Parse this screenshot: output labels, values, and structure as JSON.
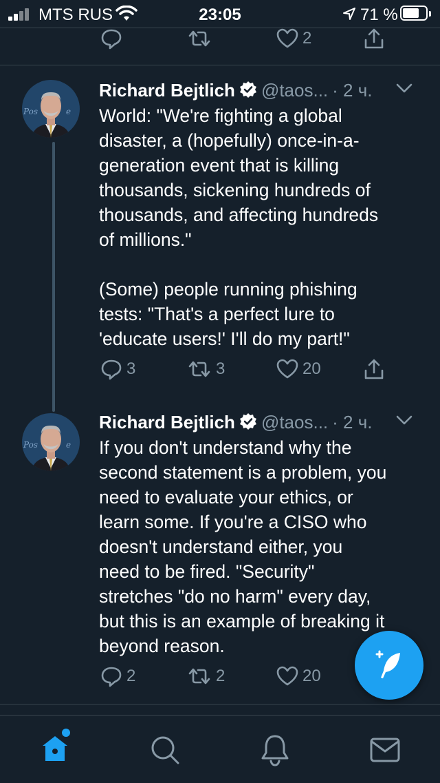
{
  "status_bar": {
    "carrier": "MTS RUS",
    "time": "23:05",
    "battery": "71 %",
    "battery_level": 0.71,
    "icons": [
      "signal-icon",
      "wifi-icon",
      "location-icon",
      "battery-icon"
    ]
  },
  "top_actions": {
    "reply": "",
    "retweet": "",
    "like": "2"
  },
  "tweets": [
    {
      "name": "Richard Bejtlich",
      "handle": "@taos...",
      "time": "· 2 ч.",
      "text": "World: \"We're fighting a global\ndisaster, a (hopefully) once-in-a-\ngeneration event that is killing\nthousands, sickening hundreds of\nthousands, and affecting hundreds\nof millions.\"\n\n(Some) people running phishing\ntests: \"That's a perfect lure to\n'educate users!' I'll do my part!\"",
      "reply_count": "3",
      "retweet_count": "3",
      "like_count": "20"
    },
    {
      "name": "Richard Bejtlich",
      "handle": "@taos...",
      "time": "· 2 ч.",
      "text": "If you don't understand why the\nsecond statement is a problem, you\nneed to evaluate your ethics, or\nlearn some. If you're a CISO who\ndoesn't understand either, you\nneed to be fired. \"Security\"\nstretches \"do no harm\" every day,\nbut this is an example of breaking it\nbeyond reason.",
      "reply_count": "2",
      "retweet_count": "2",
      "like_count": "20"
    }
  ],
  "tab_bar": [
    "home-icon",
    "search-icon",
    "notifications-icon",
    "messages-icon"
  ],
  "colors": {
    "background": "#15202b",
    "accent": "#1da1f2",
    "muted": "#8899a6",
    "divider": "#38444d"
  }
}
